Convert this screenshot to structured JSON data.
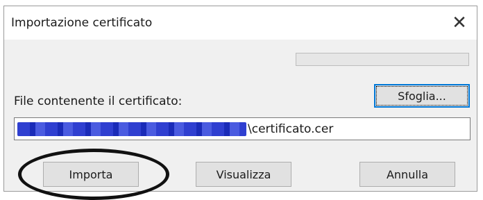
{
  "dialog": {
    "title": "Importazione certificato",
    "close_glyph": "✕",
    "progress_fraction": 0,
    "file_label": "File contenente il certificato:",
    "browse_label": "Sfoglia...",
    "path_value_visible": "\\certificato.cer",
    "buttons": {
      "import_label": "Importa",
      "view_label": "Visualizza",
      "cancel_label": "Annulla"
    }
  },
  "icons": {
    "close": "close-icon"
  },
  "colors": {
    "dialog_bg": "#f0f0f0",
    "titlebar_bg": "#ffffff",
    "focus_border": "#0078d7",
    "redaction_blue": "#2f3fd0",
    "annotation_circle": "#111111"
  }
}
